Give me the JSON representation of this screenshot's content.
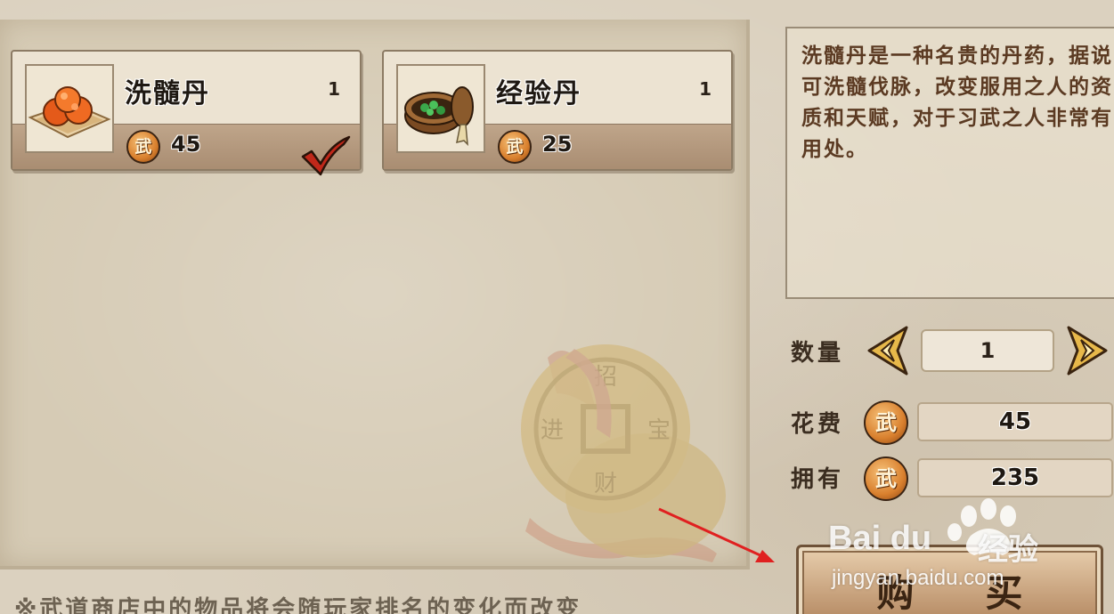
{
  "shop": {
    "items": [
      {
        "name": "洗髓丹",
        "count": "1",
        "currency_label": "武",
        "price": "45",
        "selected": true,
        "icon": "oranges-on-cloth-icon"
      },
      {
        "name": "经验丹",
        "count": "1",
        "currency_label": "武",
        "price": "25",
        "selected": false,
        "icon": "pill-box-icon"
      }
    ],
    "notice": "※武道商店中的物品将会随玩家排名的变化而改变"
  },
  "detail": {
    "description": "洗髓丹是一种名贵的丹药，据说可洗髓伐脉，改变服用之人的资质和天赋，对于习武之人非常有用处。",
    "quantity_label": "数量",
    "quantity_value": "1",
    "cost_label": "花费",
    "cost_value": "45",
    "owned_label": "拥有",
    "owned_value": "235",
    "currency_label": "武",
    "buy_label": "购买"
  },
  "watermark": {
    "brand": "Bai du",
    "product": "经验",
    "url": "jingyan.baidu.com"
  },
  "colors": {
    "parchment": "#dbd1bf",
    "card_bottom": "#a98d72",
    "description_text": "#5b3a22",
    "currency_badge": "#d9802e",
    "check_mark": "#c0281a",
    "arrow": "#e02020"
  }
}
